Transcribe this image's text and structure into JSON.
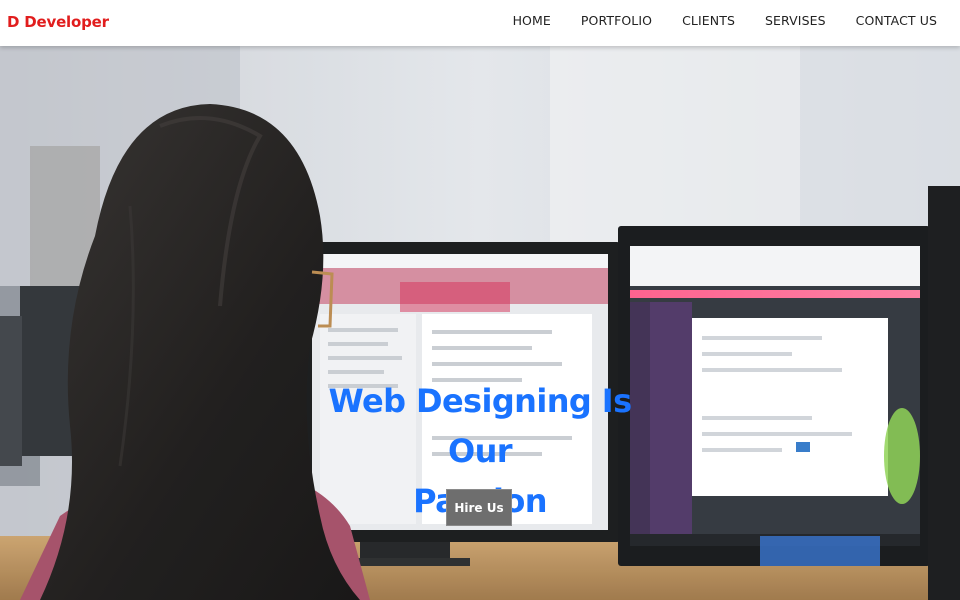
{
  "navbar": {
    "brand": "D Developer",
    "links": [
      {
        "label": "HOME"
      },
      {
        "label": "PORTFOLIO"
      },
      {
        "label": "CLIENTS"
      },
      {
        "label": "SERVISES"
      },
      {
        "label": "CONTACT US"
      }
    ]
  },
  "hero": {
    "headline_line1": "Web Designing Is Our",
    "headline_line2": "Passion",
    "cta_label": "Hire Us"
  },
  "colors": {
    "brand": "#e11d1d",
    "headline": "#1a73ff",
    "button": "#6e6e6e"
  }
}
